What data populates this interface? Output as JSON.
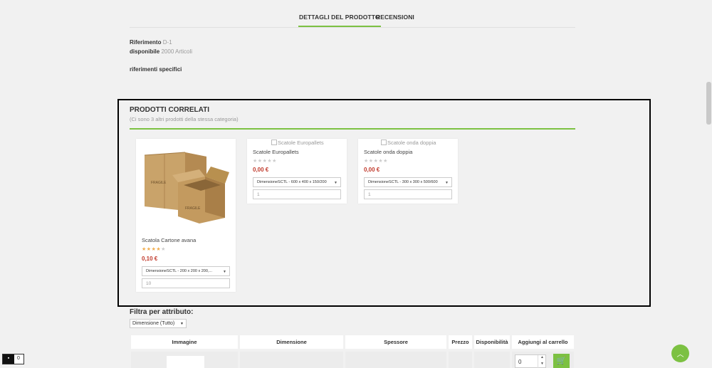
{
  "tabs": {
    "details": "DETTAGLI DEL PRODOTTO",
    "reviews": "RECENSIONI"
  },
  "details": {
    "ref_label": "Riferimento",
    "ref_value": "D-1",
    "avail_label": "disponibile",
    "avail_value": "2000 Articoli",
    "specific_refs": "riferimenti specifici"
  },
  "related": {
    "title": "PRODOTTI CORRELATI",
    "subtitle": "(Ci sono 3 altri prodotti della stessa categoria)",
    "products": [
      {
        "name": "Scatola Cartone avana",
        "price": "0,10 €",
        "rating": 4,
        "select": "DimensioneSCTL - 200 x 200 x 200,...",
        "qty": "10",
        "img_alt": ""
      },
      {
        "name": "Scatole Europallets",
        "price": "0,00 €",
        "rating": 0,
        "select": "DimensioneSCTL - 600 x 400 x 150/200",
        "qty": "1",
        "img_alt": "Scatole Europallets"
      },
      {
        "name": "Scatole onda doppia",
        "price": "0,00 €",
        "rating": 0,
        "select": "DimensioneSCTL - 300 x 300 x 500/600",
        "qty": "1",
        "img_alt": "Scatole onda doppia"
      }
    ]
  },
  "box_labels": {
    "fragile": "FRAGILE"
  },
  "filter": {
    "title": "Filtra per attributo:",
    "selected": "Dimensione (Tutto)"
  },
  "table": {
    "headers": [
      "Immagine",
      "Dimensione",
      "Spessore",
      "Prezzo",
      "Disponibilità",
      "Aggiungi al carrello"
    ],
    "row_qty": "0"
  },
  "cart": {
    "count": "0"
  },
  "colors": {
    "accent": "#7cc142",
    "price": "#c0392b",
    "frame": "#000000"
  }
}
